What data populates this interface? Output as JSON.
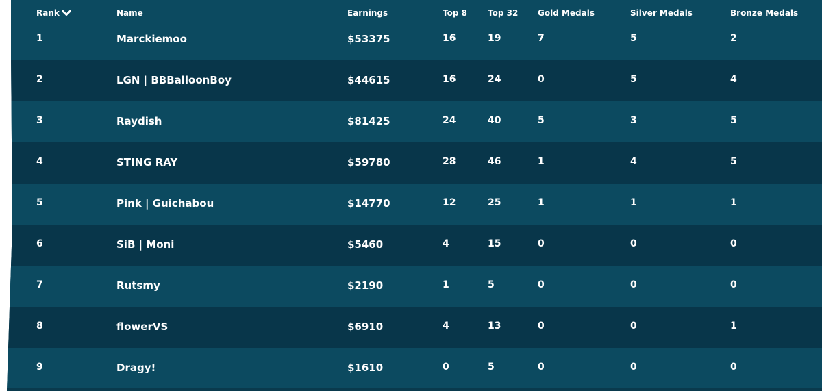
{
  "headers": {
    "rank": "Rank",
    "name": "Name",
    "earnings": "Earnings",
    "top8": "Top 8",
    "top32": "Top 32",
    "gold": "Gold Medals",
    "silver": "Silver Medals",
    "bronze": "Bronze Medals",
    "sort_icon": "chevron-down-icon"
  },
  "rows": [
    {
      "rank": "1",
      "name": "Marckiemoo",
      "earnings": "$53375",
      "top8": "16",
      "top32": "19",
      "gold": "7",
      "silver": "5",
      "bronze": "2"
    },
    {
      "rank": "2",
      "name": "LGN | BBBalloonBoy",
      "earnings": "$44615",
      "top8": "16",
      "top32": "24",
      "gold": "0",
      "silver": "5",
      "bronze": "4"
    },
    {
      "rank": "3",
      "name": "Raydish",
      "earnings": "$81425",
      "top8": "24",
      "top32": "40",
      "gold": "5",
      "silver": "3",
      "bronze": "5"
    },
    {
      "rank": "4",
      "name": "STING RAY",
      "earnings": "$59780",
      "top8": "28",
      "top32": "46",
      "gold": "1",
      "silver": "4",
      "bronze": "5"
    },
    {
      "rank": "5",
      "name": "Pink | Guichabou",
      "earnings": "$14770",
      "top8": "12",
      "top32": "25",
      "gold": "1",
      "silver": "1",
      "bronze": "1"
    },
    {
      "rank": "6",
      "name": "SiB | Moni",
      "earnings": "$5460",
      "top8": "4",
      "top32": "15",
      "gold": "0",
      "silver": "0",
      "bronze": "0"
    },
    {
      "rank": "7",
      "name": "Rutsmy",
      "earnings": "$2190",
      "top8": "1",
      "top32": "5",
      "gold": "0",
      "silver": "0",
      "bronze": "0"
    },
    {
      "rank": "8",
      "name": "flowerVS",
      "earnings": "$6910",
      "top8": "4",
      "top32": "13",
      "gold": "0",
      "silver": "0",
      "bronze": "1"
    },
    {
      "rank": "9",
      "name": "Dragy!",
      "earnings": "$1610",
      "top8": "0",
      "top32": "5",
      "gold": "0",
      "silver": "0",
      "bronze": "0"
    }
  ],
  "colors": {
    "row_light": "#0c4a60",
    "row_dark": "#08364a",
    "text": "#ffffff"
  }
}
